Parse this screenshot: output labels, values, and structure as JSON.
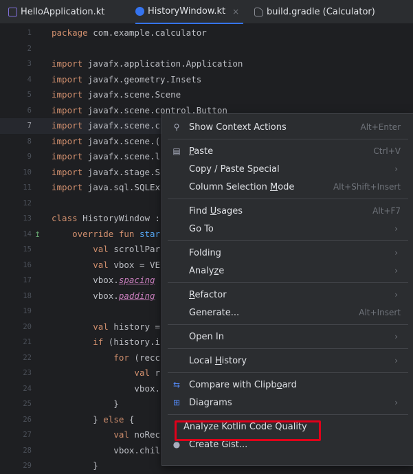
{
  "tabs": [
    {
      "label": "HelloApplication.kt",
      "icon": "kotlin-file-icon",
      "active": false
    },
    {
      "label": "HistoryWindow.kt",
      "icon": "kotlin-class-icon",
      "active": true,
      "close": "×"
    },
    {
      "label": "build.gradle (Calculator)",
      "icon": "gradle-icon",
      "active": false
    }
  ],
  "editor": {
    "current_line": 7,
    "lines": [
      {
        "n": "1",
        "text": "package com.example.calculator"
      },
      {
        "n": "2",
        "text": ""
      },
      {
        "n": "3",
        "text": "import javafx.application.Application"
      },
      {
        "n": "4",
        "text": "import javafx.geometry.Insets"
      },
      {
        "n": "5",
        "text": "import javafx.scene.Scene"
      },
      {
        "n": "6",
        "text": "import javafx.scene.control.Button"
      },
      {
        "n": "7",
        "text": "import javafx.scene.c"
      },
      {
        "n": "8",
        "text": "import javafx.scene.("
      },
      {
        "n": "9",
        "text": "import javafx.scene.l"
      },
      {
        "n": "10",
        "text": "import javafx.stage.S"
      },
      {
        "n": "11",
        "text": "import java.sql.SQLEx"
      },
      {
        "n": "12",
        "text": ""
      },
      {
        "n": "13",
        "text": "class HistoryWindow :"
      },
      {
        "n": "14",
        "text": "    override fun star"
      },
      {
        "n": "15",
        "text": "        val scrollPar"
      },
      {
        "n": "16",
        "text": "        val vbox = VE"
      },
      {
        "n": "17",
        "text": "        vbox.spacing"
      },
      {
        "n": "18",
        "text": "        vbox.padding"
      },
      {
        "n": "19",
        "text": ""
      },
      {
        "n": "20",
        "text": "        val history ="
      },
      {
        "n": "21",
        "text": "        if (history.i"
      },
      {
        "n": "22",
        "text": "            for (recc"
      },
      {
        "n": "23",
        "text": "                val r"
      },
      {
        "n": "24",
        "text": "                vbox."
      },
      {
        "n": "25",
        "text": "            }"
      },
      {
        "n": "26",
        "text": "        } else {"
      },
      {
        "n": "27",
        "text": "            val noRec"
      },
      {
        "n": "28",
        "text": "            vbox.chil"
      },
      {
        "n": "29",
        "text": "        }"
      }
    ]
  },
  "context_menu": {
    "items": [
      {
        "label": "Show Context Actions",
        "shortcut": "Alt+Enter",
        "icon": "lightbulb-icon"
      },
      {
        "separator": true
      },
      {
        "label": "Paste",
        "shortcut": "Ctrl+V",
        "icon": "clipboard-icon"
      },
      {
        "label": "Copy / Paste Special",
        "submenu": true
      },
      {
        "label": "Column Selection Mode",
        "shortcut": "Alt+Shift+Insert"
      },
      {
        "separator": true
      },
      {
        "label": "Find Usages",
        "shortcut": "Alt+F7"
      },
      {
        "label": "Go To",
        "submenu": true
      },
      {
        "separator": true
      },
      {
        "label": "Folding",
        "submenu": true
      },
      {
        "label": "Analyze",
        "submenu": true
      },
      {
        "separator": true
      },
      {
        "label": "Refactor",
        "submenu": true
      },
      {
        "label": "Generate...",
        "shortcut": "Alt+Insert"
      },
      {
        "separator": true
      },
      {
        "label": "Open In",
        "submenu": true
      },
      {
        "separator": true
      },
      {
        "label": "Local History",
        "submenu": true
      },
      {
        "separator": true
      },
      {
        "label": "Compare with Clipboard",
        "icon": "compare-icon"
      },
      {
        "label": "Diagrams",
        "submenu": true,
        "icon": "diagram-icon"
      },
      {
        "separator": true
      },
      {
        "label": "Analyze Kotlin Code Quality",
        "highlighted": true
      },
      {
        "label": "Create Gist...",
        "icon": "github-icon"
      }
    ],
    "submenu_arrow": "›",
    "highlight_color": "#e0001a"
  },
  "colors": {
    "background": "#1e1f22",
    "menu_background": "#2b2d30",
    "keyword": "#cf8e6d",
    "accent": "#3574f0"
  }
}
